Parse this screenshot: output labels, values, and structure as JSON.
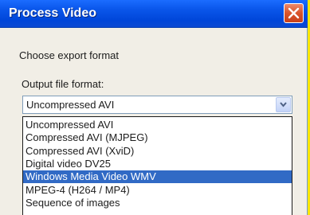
{
  "window": {
    "title": "Process Video",
    "close_icon": "close-x-icon"
  },
  "content": {
    "instruction": "Choose export format",
    "format_label": "Output file format:",
    "format_select": {
      "value": "Uncompressed AVI",
      "dropdown_icon": "chevron-down-icon"
    },
    "format_options": [
      {
        "label": "Uncompressed AVI",
        "selected": false
      },
      {
        "label": "Compressed AVI (MJPEG)",
        "selected": false
      },
      {
        "label": "Compressed AVI (XviD)",
        "selected": false
      },
      {
        "label": "Digital video DV25",
        "selected": false
      },
      {
        "label": "Windows Media Video WMV",
        "selected": true
      },
      {
        "label": "MPEG-4 (H264 / MP4)",
        "selected": false
      },
      {
        "label": "Sequence of images",
        "selected": false
      }
    ]
  },
  "colors": {
    "titlebar": "#0a56ea",
    "highlight": "#316ac5",
    "close_button": "#d9542a",
    "background": "#f1eee6",
    "outer_border": "#fbe600"
  }
}
